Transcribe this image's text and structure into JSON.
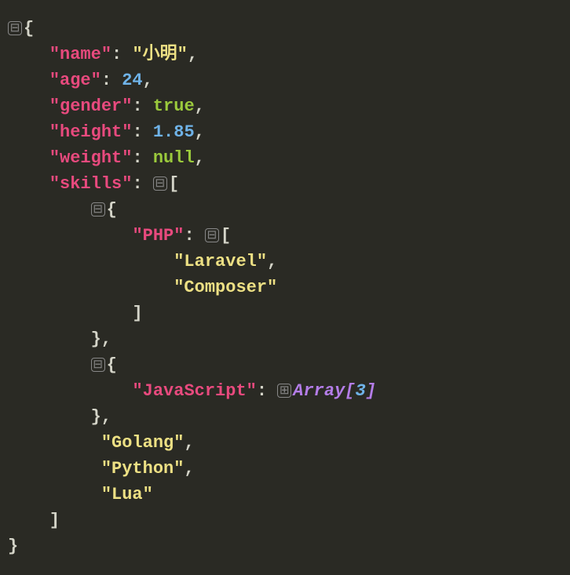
{
  "icons": {
    "collapse": "⊟",
    "expand": "⊞"
  },
  "json": {
    "keys": {
      "name": "\"name\"",
      "age": "\"age\"",
      "gender": "\"gender\"",
      "height": "\"height\"",
      "weight": "\"weight\"",
      "skills": "\"skills\"",
      "php": "\"PHP\"",
      "javascript": "\"JavaScript\""
    },
    "values": {
      "name": "\"小明\"",
      "age": "24",
      "gender": "true",
      "height": "1.85",
      "weight": "null",
      "laravel": "\"Laravel\"",
      "composer": "\"Composer\"",
      "golang": "\"Golang\"",
      "python": "\"Python\"",
      "lua": "\"Lua\""
    },
    "collapsed": {
      "array_label": "Array[",
      "array_count": "3",
      "array_close": "]"
    },
    "punct": {
      "colon": ":",
      "comma": ",",
      "obrace": "{",
      "cbrace": "}",
      "obracket": "[",
      "cbracket": "]"
    }
  }
}
